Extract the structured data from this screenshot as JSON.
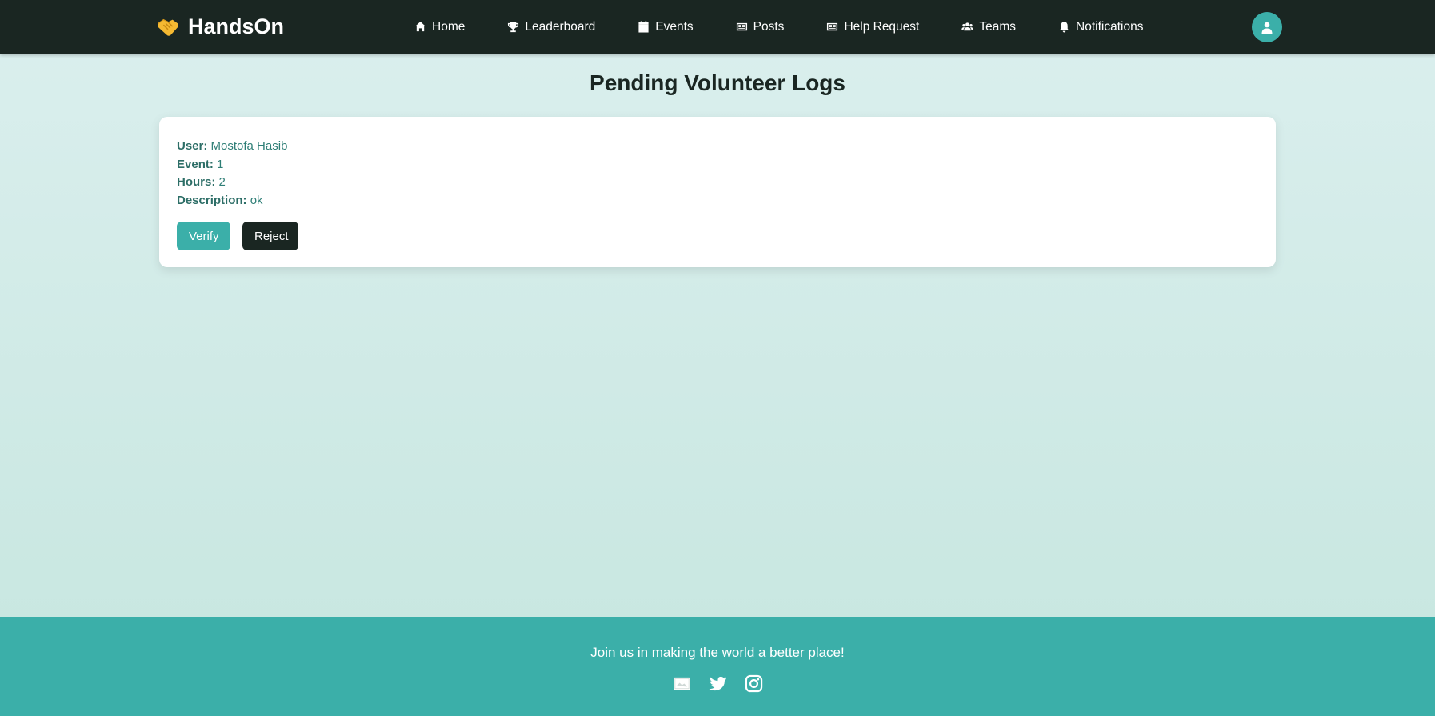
{
  "brand": {
    "name": "HandsOn",
    "logo_icon": "handshake-icon",
    "logo_color": "#f5b932"
  },
  "nav": {
    "items": [
      {
        "label": "Home",
        "icon": "home-icon"
      },
      {
        "label": "Leaderboard",
        "icon": "trophy-icon"
      },
      {
        "label": "Events",
        "icon": "calendar-icon"
      },
      {
        "label": "Posts",
        "icon": "newspaper-icon"
      },
      {
        "label": "Help Request",
        "icon": "newspaper-icon"
      },
      {
        "label": "Teams",
        "icon": "users-icon"
      },
      {
        "label": "Notifications",
        "icon": "bell-icon"
      }
    ],
    "avatar_icon": "user-icon"
  },
  "main": {
    "title": "Pending Volunteer Logs",
    "logs": [
      {
        "user_label": "User:",
        "user": "Mostofa Hasib",
        "event_label": "Event:",
        "event": "1",
        "hours_label": "Hours:",
        "hours": "2",
        "description_label": "Description:",
        "description": "ok",
        "verify_label": "Verify",
        "reject_label": "Reject"
      }
    ]
  },
  "footer": {
    "tagline": "Join us in making the world a better place!",
    "socials": [
      {
        "icon": "facebook-icon"
      },
      {
        "icon": "twitter-icon"
      },
      {
        "icon": "instagram-icon"
      }
    ]
  },
  "colors": {
    "navbar": "#1a2622",
    "accent": "#3bafa9",
    "dark_button": "#1a2622",
    "label_text": "#2d6e67"
  }
}
